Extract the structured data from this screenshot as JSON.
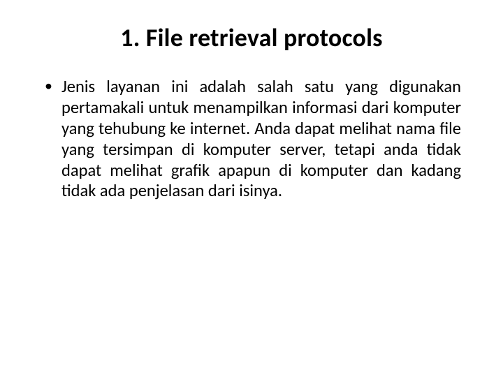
{
  "slide": {
    "title": "1. File retrieval protocols",
    "bullets": [
      "Jenis layanan ini adalah salah satu yang digunakan pertamakali untuk menampilkan informasi dari komputer yang tehubung ke internet. Anda dapat melihat nama file yang tersimpan di komputer server, tetapi anda tidak dapat melihat grafik apapun di komputer dan kadang tidak ada penjelasan dari isinya."
    ]
  }
}
